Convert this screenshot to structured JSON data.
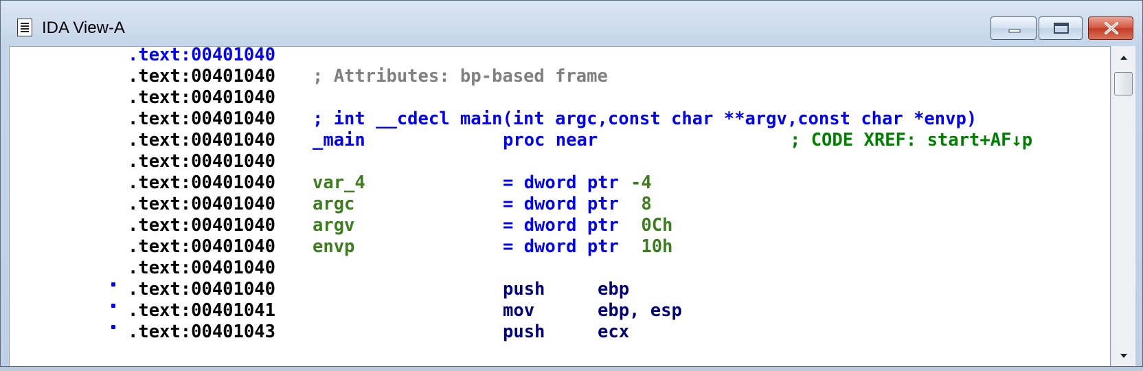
{
  "window": {
    "title": "IDA View-A",
    "icon": "document-icon"
  },
  "controls": {
    "minimize_icon": "minimize-icon",
    "maximize_icon": "maximize-icon",
    "close_icon": "close-icon"
  },
  "colors": {
    "address_blue": "#0000ff",
    "comment_gray": "#808080",
    "identifier_green": "#3c7d1e",
    "instruction_navy": "#000080",
    "xref_green": "#008000",
    "breakpoint_dot": "#0000ff"
  },
  "listing": [
    {
      "addr": ".text:00401040",
      "addr_blue": true
    },
    {
      "addr": ".text:00401040",
      "comment": "; Attributes: bp-based frame"
    },
    {
      "addr": ".text:00401040"
    },
    {
      "addr": ".text:00401040",
      "signature": "; int __cdecl main(int argc,const char **argv,const char *envp)"
    },
    {
      "addr": ".text:00401040",
      "label": "_main",
      "op": "proc near",
      "xref": "; CODE XREF: start+AF↓p"
    },
    {
      "addr": ".text:00401040"
    },
    {
      "addr": ".text:00401040",
      "var": "var_4",
      "op": "= dword ptr",
      "val": "-4"
    },
    {
      "addr": ".text:00401040",
      "var": "argc",
      "op": "= dword ptr",
      "val": " 8"
    },
    {
      "addr": ".text:00401040",
      "var": "argv",
      "op": "= dword ptr",
      "val": " 0Ch"
    },
    {
      "addr": ".text:00401040",
      "var": "envp",
      "op": "= dword ptr",
      "val": " 10h"
    },
    {
      "addr": ".text:00401040"
    },
    {
      "addr": ".text:00401040",
      "dot": true,
      "mnem": "push",
      "operands": "ebp"
    },
    {
      "addr": ".text:00401041",
      "dot": true,
      "mnem": "mov",
      "operands": "ebp, esp"
    },
    {
      "addr": ".text:00401043",
      "dot": true,
      "mnem": "push",
      "operands": "ecx"
    }
  ]
}
